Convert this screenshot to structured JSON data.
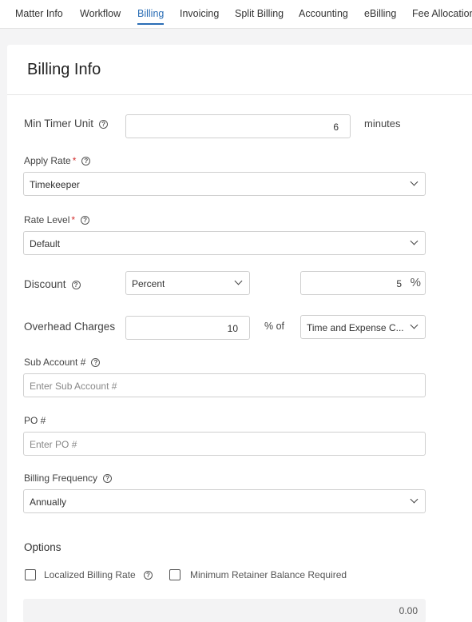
{
  "tabs": [
    {
      "label": "Matter Info"
    },
    {
      "label": "Workflow"
    },
    {
      "label": "Billing"
    },
    {
      "label": "Invoicing"
    },
    {
      "label": "Split Billing"
    },
    {
      "label": "Accounting"
    },
    {
      "label": "eBilling"
    },
    {
      "label": "Fee Allocation"
    }
  ],
  "active_tab": "Billing",
  "section_title": "Billing Info",
  "help_glyph": "?",
  "required_marker": "*",
  "min_timer_unit": {
    "label": "Min Timer Unit",
    "value": "6",
    "unit": "minutes"
  },
  "apply_rate": {
    "label": "Apply Rate",
    "value": "Timekeeper"
  },
  "rate_level": {
    "label": "Rate Level",
    "value": "Default"
  },
  "discount": {
    "label": "Discount",
    "type_value": "Percent",
    "amount": "5",
    "unit_symbol": "%"
  },
  "overhead_charges": {
    "label": "Overhead Charges",
    "value": "10",
    "pct_of": "% of",
    "basis_value": "Time and Expense C..."
  },
  "sub_account": {
    "label": "Sub Account #",
    "placeholder": "Enter Sub Account #"
  },
  "po": {
    "label": "PO #",
    "placeholder": "Enter PO #"
  },
  "billing_frequency": {
    "label": "Billing Frequency",
    "value": "Annually"
  },
  "options": {
    "title": "Options",
    "localized_billing_rate": {
      "label": "Localized Billing Rate",
      "checked": false
    },
    "min_retainer_balance": {
      "label": "Minimum Retainer Balance Required",
      "checked": false
    }
  },
  "retainer_amount": "0.00"
}
